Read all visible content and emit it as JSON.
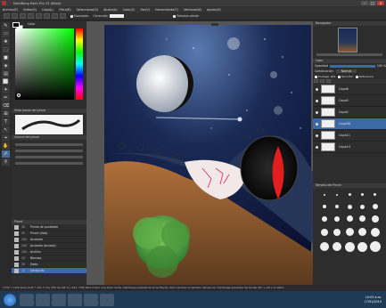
{
  "window": {
    "title": "MediBang Paint Pro 23 (64bit)"
  },
  "menu": [
    "Archivo(F)",
    "Editar(E)",
    "Capa(L)",
    "Filtro(R)",
    "Seleccionar(S)",
    "Ajuste(A)",
    "Color(C)",
    "Ver(V)",
    "Herramienta(T)",
    "Ventana(W)",
    "Ayuda(H)"
  ],
  "tool_options": {
    "correction_label": "Corrección",
    "correction_value": "0",
    "suavizado": "Suavizado",
    "tilt": "Rotacion-desde"
  },
  "color_panel": {
    "title": "Color"
  },
  "brush_preview": {
    "title": "Vista previa del pincel"
  },
  "brush_size_panel": {
    "title": "Control del pincel"
  },
  "brush_list": {
    "title": "Pincel",
    "items": [
      {
        "size": "30",
        "name": "Pluma de punteado"
      },
      {
        "size": "30",
        "name": "Pincel (lista)"
      },
      {
        "size": "100",
        "name": "Acuarela"
      },
      {
        "size": "100",
        "name": "Acuarela (acuoso)"
      },
      {
        "size": "100",
        "name": "Acrílico"
      },
      {
        "size": "10",
        "name": "Borrosa"
      },
      {
        "size": "30",
        "name": "Dedo"
      },
      {
        "size": "10",
        "name": "Aerógrafo"
      }
    ],
    "selected_index": 7
  },
  "navigator": {
    "title": "Navegador"
  },
  "layers": {
    "title": "Capa",
    "opacity_label": "Opacidad",
    "opacity_value": "100 %",
    "blend_label": "Combinación",
    "blend_value": "Normal",
    "protect_alpha": "Proteger alfa",
    "clipping": "Recortar",
    "ref": "Referencia",
    "items": [
      "Capa6",
      "Capa5",
      "Capa2",
      "Capa38",
      "Capa11",
      "Capa10"
    ],
    "selected": "Capa38"
  },
  "brush_size_panel2": {
    "title": "Tamaño del Pincel"
  },
  "status": {
    "text": "1732 * 1430 pixel  (124 * 101.7 cm)  350 dpi  48 %  (-341, 738)  Para trazar una línea recta, mantenga pulsada la tecla Mayús. Para cambiar el tamaño del pincel, mantenga pulsadas las teclas Ctrl + Alt y arrastre"
  },
  "taskbar": {
    "time": "10:03 a.m.",
    "date": "17/01/2019"
  },
  "colors": {
    "accent": "#3d6aa6",
    "eye_red": "#e21d1d"
  }
}
